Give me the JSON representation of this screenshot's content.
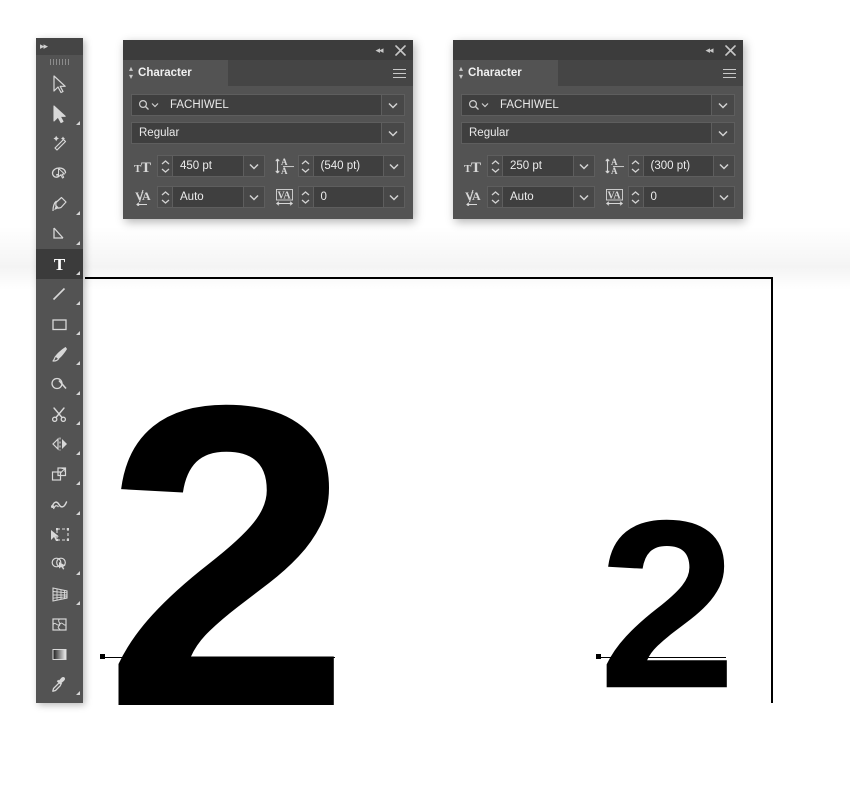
{
  "app": {
    "canvas_background": "#ffffff",
    "panel_background": "#535353",
    "panel_titlebar": "#3c3c3c",
    "field_background": "#3f3f3f",
    "text_color": "#e8e8e8",
    "artboard_border": "#000000"
  },
  "toolbar": {
    "collapse_icon": "double-chevron-right",
    "tools": [
      {
        "name": "selection-tool",
        "has_flyout": false,
        "selected": false
      },
      {
        "name": "direct-selection-tool",
        "has_flyout": true,
        "selected": false
      },
      {
        "name": "magic-wand-tool",
        "has_flyout": false,
        "selected": false
      },
      {
        "name": "lasso-tool",
        "has_flyout": false,
        "selected": false
      },
      {
        "name": "pen-tool",
        "has_flyout": true,
        "selected": false
      },
      {
        "name": "curvature-tool",
        "has_flyout": false,
        "selected": false
      },
      {
        "name": "type-tool",
        "has_flyout": true,
        "selected": true
      },
      {
        "name": "line-segment-tool",
        "has_flyout": true,
        "selected": false
      },
      {
        "name": "rectangle-tool",
        "has_flyout": true,
        "selected": false
      },
      {
        "name": "paintbrush-tool",
        "has_flyout": true,
        "selected": false
      },
      {
        "name": "shaper-tool",
        "has_flyout": true,
        "selected": false
      },
      {
        "name": "scissors-tool",
        "has_flyout": true,
        "selected": false
      },
      {
        "name": "reflect-tool",
        "has_flyout": true,
        "selected": false
      },
      {
        "name": "scale-tool",
        "has_flyout": true,
        "selected": false
      },
      {
        "name": "width-tool",
        "has_flyout": true,
        "selected": false
      },
      {
        "name": "free-transform-tool",
        "has_flyout": false,
        "selected": false
      },
      {
        "name": "shape-builder-tool",
        "has_flyout": true,
        "selected": false
      },
      {
        "name": "perspective-grid-tool",
        "has_flyout": true,
        "selected": false
      },
      {
        "name": "mesh-tool",
        "has_flyout": false,
        "selected": false
      },
      {
        "name": "gradient-tool",
        "has_flyout": false,
        "selected": false
      },
      {
        "name": "eyedropper-tool",
        "has_flyout": true,
        "selected": false
      }
    ]
  },
  "panels": [
    {
      "id": "character-panel-1",
      "title": "Character",
      "menu_icon": "hamburger-icon",
      "collapse_icon": "double-chevron-left",
      "close_icon": "close-icon",
      "font_family": {
        "label": "font-family",
        "value": "FACHIWEL",
        "search_icon": "search-icon",
        "caret_icon": "chevron-down-icon"
      },
      "font_style": {
        "label": "font-style",
        "value": "Regular",
        "caret_icon": "chevron-down-icon"
      },
      "font_size": {
        "icon": "font-size-icon",
        "value": "450 pt"
      },
      "leading": {
        "icon": "leading-icon",
        "value": "(540 pt)"
      },
      "kerning": {
        "icon": "kerning-icon",
        "value": "Auto"
      },
      "tracking": {
        "icon": "tracking-icon",
        "value": "0"
      }
    },
    {
      "id": "character-panel-2",
      "title": "Character",
      "menu_icon": "hamburger-icon",
      "collapse_icon": "double-chevron-left",
      "close_icon": "close-icon",
      "font_family": {
        "label": "font-family",
        "value": "FACHIWEL",
        "search_icon": "search-icon",
        "caret_icon": "chevron-down-icon"
      },
      "font_style": {
        "label": "font-style",
        "value": "Regular",
        "caret_icon": "chevron-down-icon"
      },
      "font_size": {
        "icon": "font-size-icon",
        "value": "250 pt"
      },
      "leading": {
        "icon": "leading-icon",
        "value": "(300 pt)"
      },
      "kerning": {
        "icon": "kerning-icon",
        "value": "Auto"
      },
      "tracking": {
        "icon": "tracking-icon",
        "value": "0"
      }
    }
  ],
  "artwork": {
    "objects": [
      {
        "name": "type-object-large",
        "text": "2",
        "rendered_size_pt": "450 pt"
      },
      {
        "name": "type-object-small",
        "text": "2",
        "rendered_size_pt": "250 pt"
      }
    ]
  }
}
